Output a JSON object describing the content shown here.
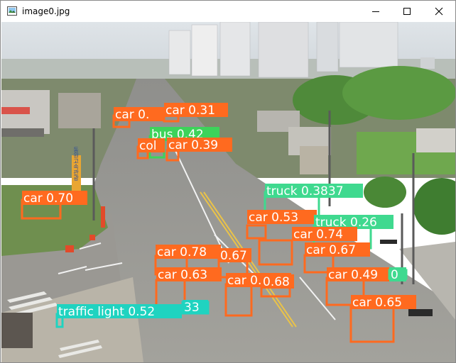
{
  "window": {
    "title": "image0.jpg",
    "icons": {
      "app": "image-file-icon",
      "minimize": "minimize-icon",
      "maximize": "maximize-icon",
      "close": "close-icon"
    }
  },
  "colors": {
    "car": "#ff6a1f",
    "bus": "#3dd35a",
    "truck": "#3fd98f",
    "traffic_light": "#1fd3c0",
    "label_text": "#ffffff"
  },
  "detections": [
    {
      "label": "car 0.70"
    },
    {
      "label": "car 0.31"
    },
    {
      "label": "car 0."
    },
    {
      "label": "bus 0.42"
    },
    {
      "label": "car 0.39"
    },
    {
      "label": "col"
    },
    {
      "label": "truck 0.3837"
    },
    {
      "label": "car 0.53"
    },
    {
      "label": "truck 0.26"
    },
    {
      "label": "car 0.74"
    },
    {
      "label": "car 0.67"
    },
    {
      "label": "car 0.78"
    },
    {
      "label": "0.67"
    },
    {
      "label": "car 0.63"
    },
    {
      "label": "car 0.78"
    },
    {
      "label": "0.68"
    },
    {
      "label": "car 0.49"
    },
    {
      "label": "0"
    },
    {
      "label": "car 0.65"
    },
    {
      "label": "traffic light 0.52"
    },
    {
      "label": "33"
    }
  ],
  "signs": [
    {
      "text": "동원고속관광"
    }
  ]
}
